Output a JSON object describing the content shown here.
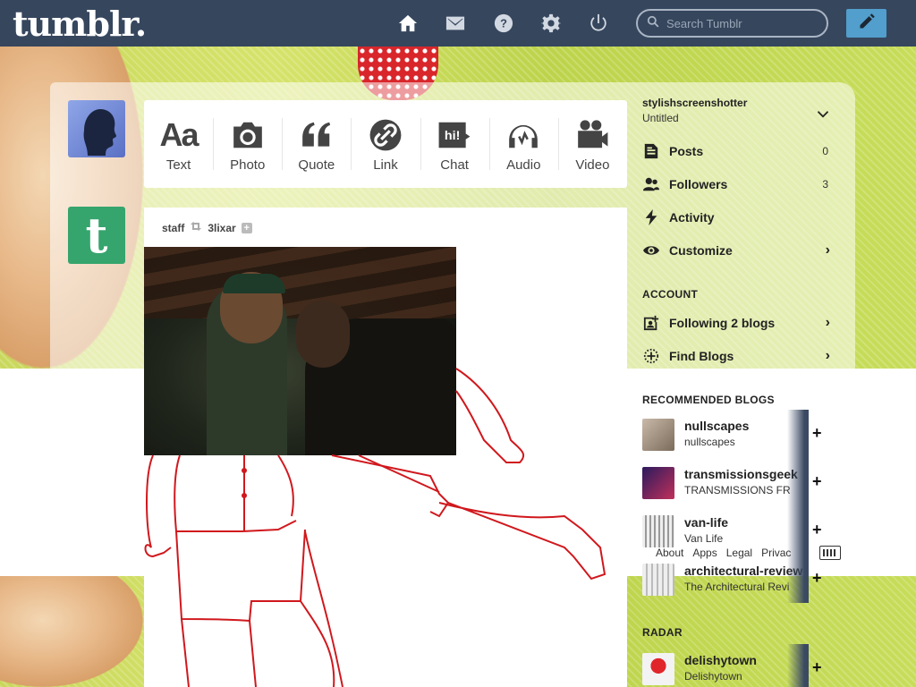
{
  "header": {
    "logo": "tumblr.",
    "search_placeholder": "Search Tumblr",
    "nav": [
      "home-icon",
      "mail-icon",
      "help-icon",
      "settings-icon",
      "power-icon"
    ],
    "compose_icon": "pencil-icon",
    "colors": {
      "bar": "#36465d",
      "compose": "#529ecc"
    }
  },
  "post_types": [
    {
      "label": "Text",
      "icon": "text-icon"
    },
    {
      "label": "Photo",
      "icon": "camera-icon"
    },
    {
      "label": "Quote",
      "icon": "quote-icon"
    },
    {
      "label": "Link",
      "icon": "link-icon"
    },
    {
      "label": "Chat",
      "icon": "chat-icon"
    },
    {
      "label": "Audio",
      "icon": "headphones-icon"
    },
    {
      "label": "Video",
      "icon": "video-camera-icon"
    }
  ],
  "post": {
    "author": "staff",
    "reblogged_from": "3lixar"
  },
  "sidebar": {
    "blog_name": "stylishscreenshotter",
    "blog_title": "Untitled",
    "menu": [
      {
        "label": "Posts",
        "count": "0",
        "icon": "posts-icon"
      },
      {
        "label": "Followers",
        "count": "3",
        "icon": "followers-icon"
      },
      {
        "label": "Activity",
        "icon": "lightning-icon"
      },
      {
        "label": "Customize",
        "icon": "eye-icon"
      }
    ],
    "account_heading": "ACCOUNT",
    "account_menu": [
      {
        "label": "Following 2 blogs",
        "icon": "following-icon"
      },
      {
        "label": "Find Blogs",
        "icon": "find-blogs-icon"
      }
    ],
    "recommended_heading": "RECOMMENDED BLOGS",
    "recommended": [
      {
        "name": "nullscapes",
        "title": "nullscapes"
      },
      {
        "name": "transmissionsgeek",
        "title": "TRANSMISSIONS FR"
      },
      {
        "name": "van-life",
        "title": "Van Life"
      },
      {
        "name": "architectural-review",
        "title": "The Architectural Revi"
      }
    ],
    "radar_heading": "RADAR",
    "radar": {
      "name": "delishytown",
      "title": "Delishytown"
    },
    "footer_links": [
      "About",
      "Apps",
      "Legal",
      "Privac"
    ]
  }
}
